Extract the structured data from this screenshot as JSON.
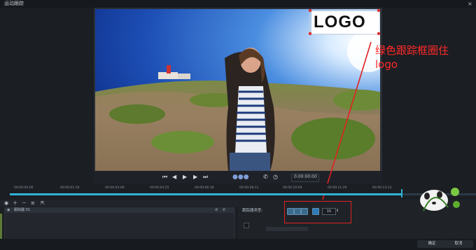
{
  "window": {
    "title": "运动跟踪",
    "close_glyph": "×"
  },
  "preview": {
    "logo_text": "LOGO",
    "timecode": "0:00:00:00"
  },
  "annotation": {
    "text_line1": "绿色跟踪框圈住",
    "text_line2": "logo",
    "color": "#ff2a2a"
  },
  "timeline": {
    "ticks": [
      "00:00:00:00",
      "00:00:01:16",
      "00:00:03:09",
      "00:00:04:25",
      "00:00:06:18",
      "00:00:08:11",
      "00:00:10:04",
      "00:00:11:20",
      "00:00:13:13"
    ],
    "progress_fraction": 0.84
  },
  "tracker": {
    "list_item": "跟踪器 01",
    "type_label": "跟踪器类型:",
    "spin_value": "15"
  },
  "buttons": {
    "ok": "确定",
    "cancel": "取消"
  },
  "colors": {
    "accent": "#2fb2d8",
    "highlight": "#e02020"
  }
}
